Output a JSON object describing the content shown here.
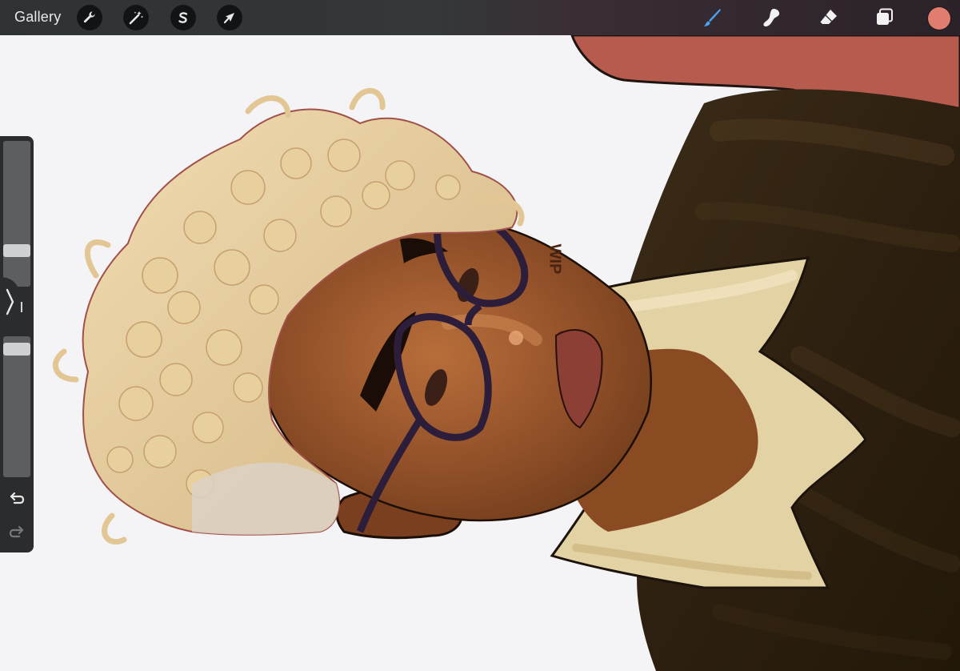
{
  "toolbar": {
    "gallery_label": "Gallery",
    "left_tools": [
      {
        "name": "actions",
        "icon": "wrench-icon"
      },
      {
        "name": "adjustments",
        "icon": "magic-wand-icon"
      },
      {
        "name": "selection",
        "icon": "selection-s-icon"
      },
      {
        "name": "transform",
        "icon": "arrow-cursor-icon"
      }
    ],
    "right_tools": [
      {
        "name": "brush",
        "icon": "brush-icon",
        "active": true
      },
      {
        "name": "smudge",
        "icon": "smudge-icon"
      },
      {
        "name": "eraser",
        "icon": "eraser-icon"
      },
      {
        "name": "layers",
        "icon": "layers-icon"
      }
    ],
    "current_color": "#e07d6f",
    "active_tool_color": "#4aa3f0"
  },
  "canvas": {
    "wip_text": "WIP",
    "background_color": "#f4f3f5"
  },
  "sidebar": {
    "brush_size_level": 0.72,
    "opacity_level": 0.0,
    "icons": [
      "modify-button-icon",
      "sidebar-handle-icon",
      "undo-icon",
      "redo-icon"
    ]
  }
}
